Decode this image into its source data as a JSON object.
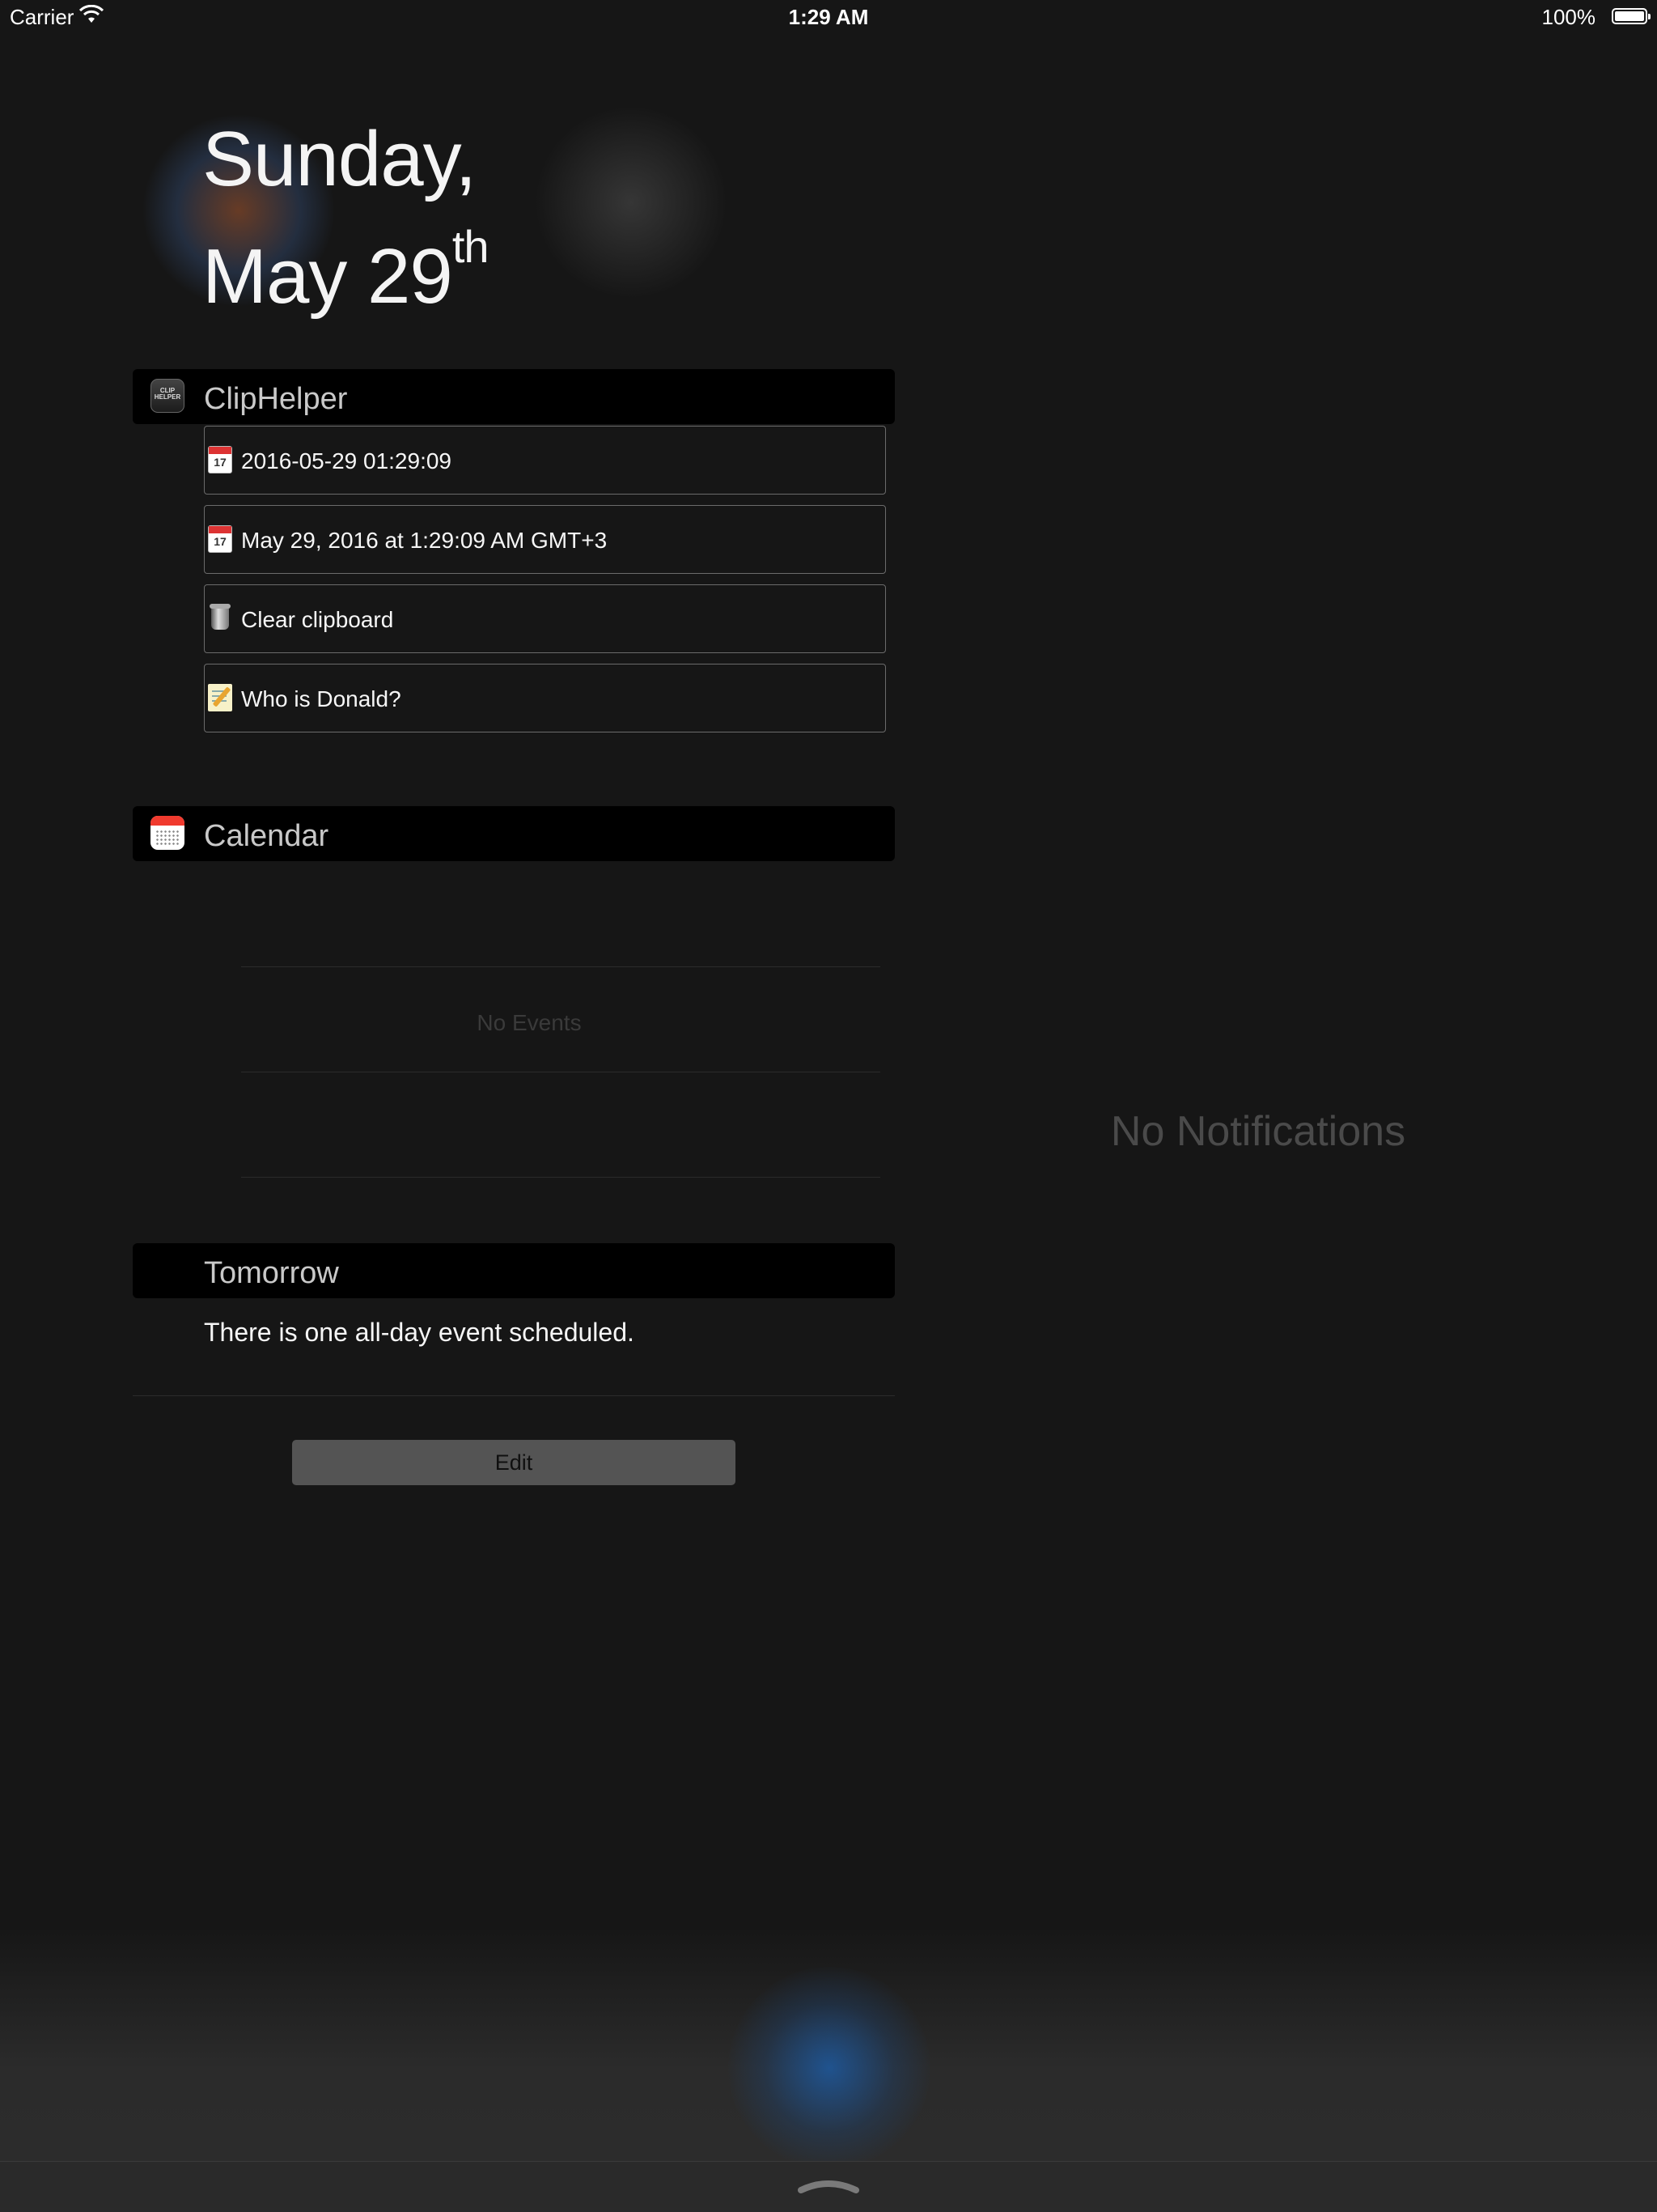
{
  "status_bar": {
    "carrier": "Carrier",
    "time": "1:29 AM",
    "battery": "100%",
    "icons": [
      "wifi-icon",
      "battery-icon"
    ]
  },
  "date": {
    "line1": "Sunday,",
    "line2": "May 29",
    "suffix": "th"
  },
  "cliphelper": {
    "title": "ClipHelper",
    "icon": "cliphelper-app-icon",
    "icon_text": "CLIP HELPER",
    "items": [
      {
        "icon": "calendar-icon",
        "icon_day": "17",
        "label": "2016-05-29 01:29:09"
      },
      {
        "icon": "calendar-icon",
        "icon_day": "17",
        "label": "May 29, 2016 at 1:29:09 AM GMT+3"
      },
      {
        "icon": "wastebasket-icon",
        "label": "Clear clipboard"
      },
      {
        "icon": "memo-icon",
        "label": "Who is Donald?"
      }
    ]
  },
  "calendar": {
    "title": "Calendar",
    "icon": "calendar-app-icon",
    "empty_text": "No Events"
  },
  "tomorrow": {
    "title": "Tomorrow",
    "text": "There is one all-day event scheduled."
  },
  "notifications": {
    "empty_text": "No Notifications"
  },
  "edit_button": {
    "label": "Edit"
  },
  "colors": {
    "background": "#161616",
    "header_bar": "#000000",
    "edit_button": "#545454",
    "muted_text": "#4a4a4a"
  }
}
